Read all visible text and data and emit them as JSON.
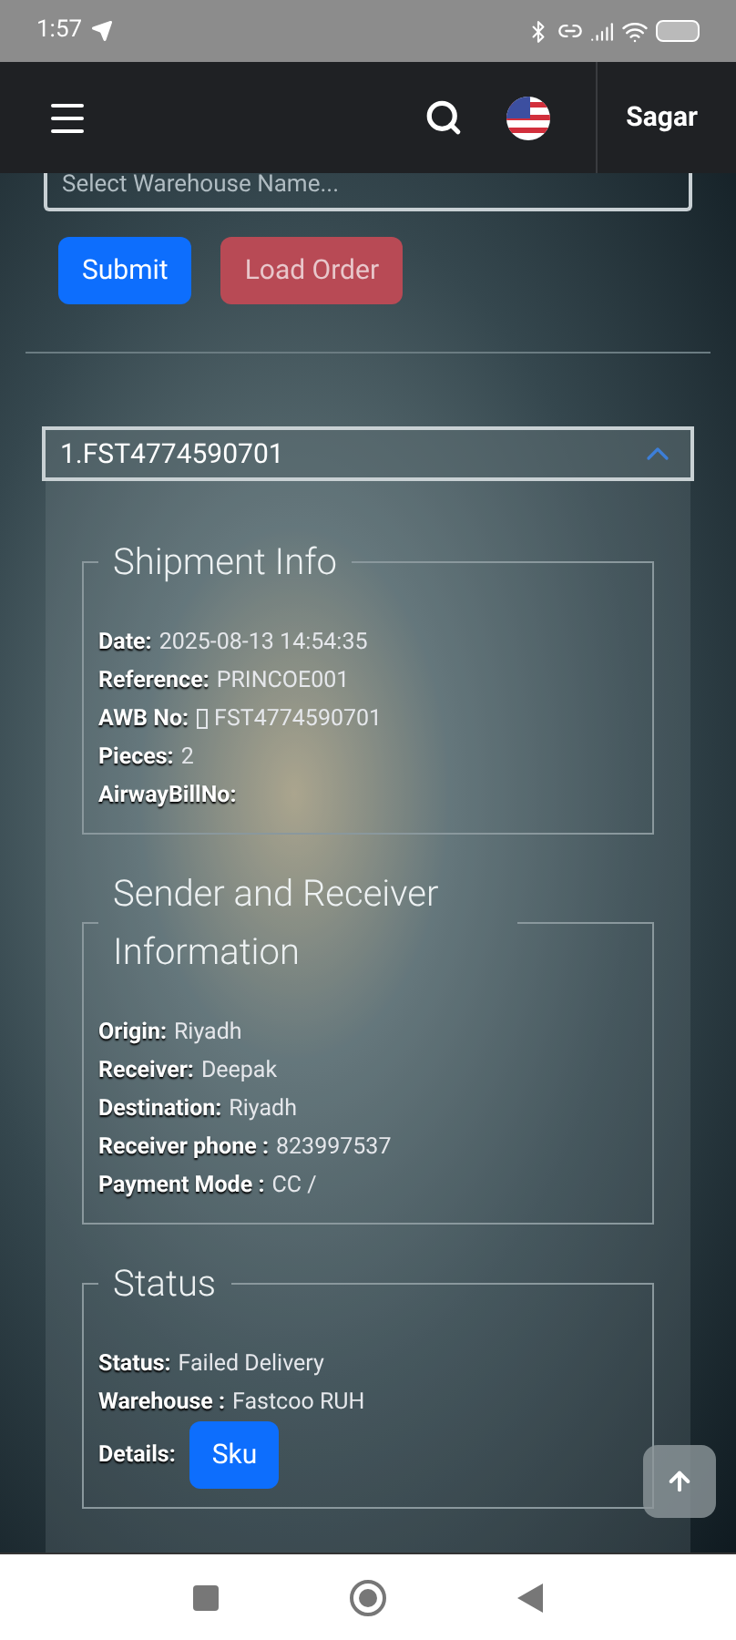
{
  "status_bar": {
    "time": "1:57"
  },
  "header": {
    "user": "Sagar"
  },
  "warehouse_select": {
    "placeholder": "Select Warehouse Name..."
  },
  "buttons": [
    {
      "label": "Submit",
      "kind": "primary"
    },
    {
      "label": "Load Order",
      "kind": "danger"
    }
  ],
  "order": {
    "title": "1.FST4774590701",
    "expanded": true,
    "sections": [
      {
        "title": "Shipment Info",
        "rows": [
          {
            "label": "Date:",
            "value": "2025-08-13 14:54:35"
          },
          {
            "label": "Reference:",
            "value": "PRINCOE001"
          },
          {
            "label": "AWB No:",
            "value": "FST4774590701",
            "kind": "icon"
          },
          {
            "label": "Pieces:",
            "value": "2"
          },
          {
            "label": "AirwayBillNo:"
          }
        ]
      },
      {
        "title": "Sender and Receiver Information",
        "rows": [
          {
            "label": "Origin:",
            "value": "Riyadh"
          },
          {
            "label": "Receiver:",
            "value": "Deepak"
          },
          {
            "label": "Destination:",
            "value": "Riyadh"
          },
          {
            "label": "Receiver phone :",
            "value": "823997537"
          },
          {
            "label": "Payment Mode :",
            "value": "CC /"
          }
        ]
      },
      {
        "title": "Status",
        "rows": [
          {
            "label": "Status:",
            "value": "Failed Delivery"
          },
          {
            "label": "Warehouse :",
            "value": "Fastcoo RUH"
          },
          {
            "label": "Details:",
            "button": "Sku",
            "kind": "button"
          }
        ]
      }
    ]
  }
}
